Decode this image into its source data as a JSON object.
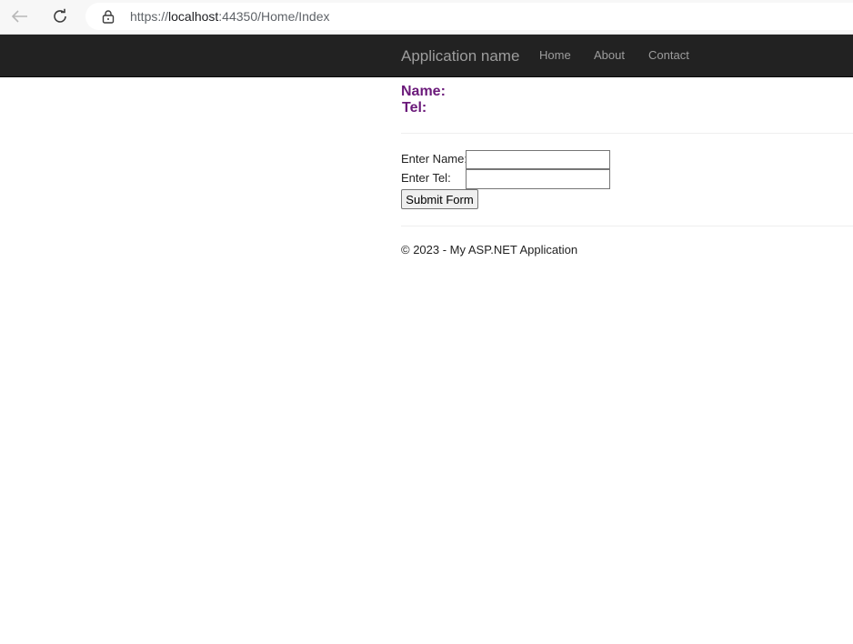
{
  "browser": {
    "url_scheme": "https://",
    "url_host": "localhost",
    "url_rest": ":44350/Home/Index",
    "icons": [
      "back-arrow-icon",
      "reload-icon",
      "lock-icon"
    ]
  },
  "navbar": {
    "brand": "Application name",
    "links": [
      "Home",
      "About",
      "Contact"
    ]
  },
  "info": {
    "name_label": "Name:",
    "tel_label": "Tel:"
  },
  "form": {
    "name_label": "Enter Name:",
    "name_value": "",
    "tel_label": "Enter Tel:",
    "tel_value": "",
    "submit_label": "Submit Form"
  },
  "footer": {
    "text": "© 2023 - My ASP.NET Application"
  },
  "colors": {
    "navbar_bg": "#222222",
    "nav_text": "#9d9d9d",
    "info_label": "#6b1a7a"
  }
}
